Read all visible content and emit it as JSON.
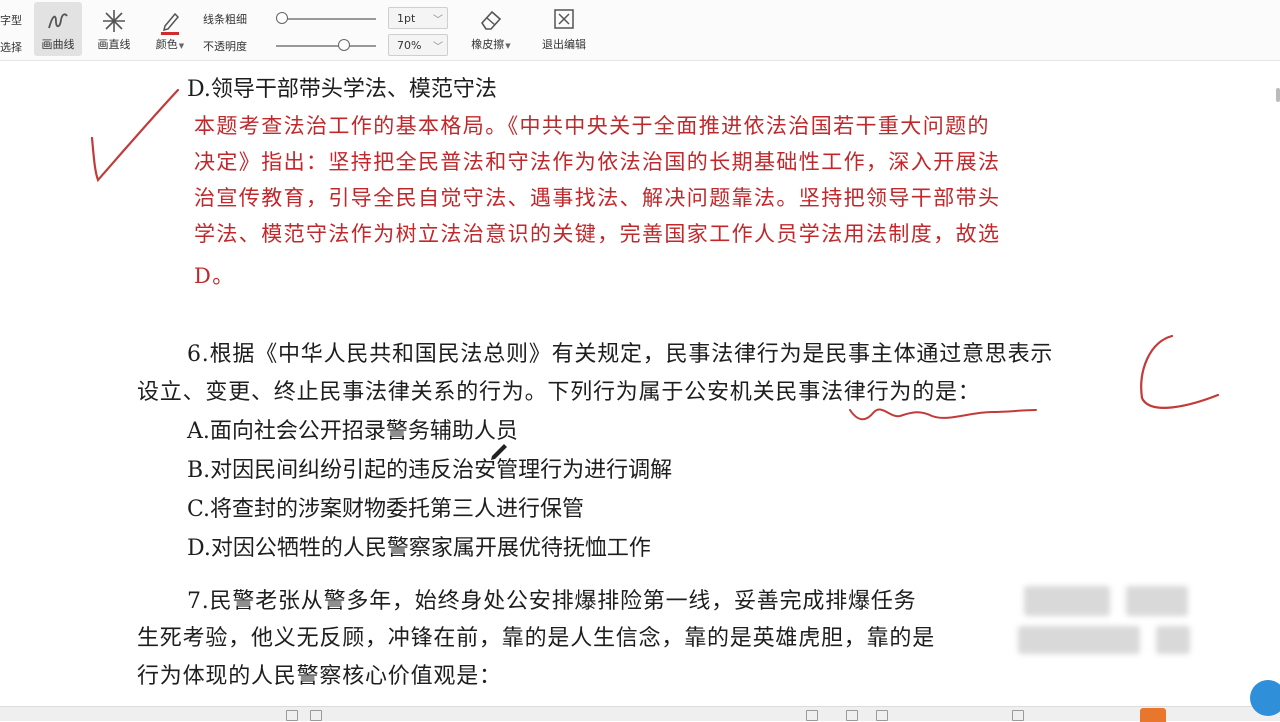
{
  "toolbar": {
    "cut_top": "字型",
    "cut_bottom": "选择",
    "curve_label": "画曲线",
    "straight_label": "画直线",
    "color_label": "颜色",
    "thickness_label": "线条粗细",
    "opacity_label": "不透明度",
    "thickness_value": "1pt",
    "opacity_value": "70%",
    "eraser_label": "橡皮擦",
    "exit_label": "退出编辑",
    "thickness_level": 0.0,
    "opacity_level": 0.7
  },
  "document": {
    "option_d": "D.领导干部带头学法、模范守法",
    "explanation": [
      "本题考查法治工作的基本格局。《中共中央关于全面推进依法治国若干重大问题的",
      "决定》指出：坚持把全民普法和守法作为依法治国的长期基础性工作，深入开展法",
      "治宣传教育，引导全民自觉守法、遇事找法、解决问题靠法。坚持把领导干部带头",
      "学法、模范守法作为树立法治意识的关键，完善国家工作人员学法用法制度，故选",
      "D。"
    ],
    "q6": {
      "line1": "6.根据《中华人民共和国民法总则》有关规定，民事法律行为是民事主体通过意思表示",
      "line2": "设立、变更、终止民事法律关系的行为。下列行为属于公安机关民事法律行为的是：",
      "options": [
        "A.面向社会公开招录警务辅助人员",
        "B.对因民间纠纷引起的违反治安管理行为进行调解",
        "C.将查封的涉案财物委托第三人进行保管",
        "D.对因公牺牲的人民警察家属开展优待抚恤工作"
      ]
    },
    "q7": {
      "line1": "7.民警老张从警多年，始终身处公安排爆排险第一线，妥善完成排爆任务",
      "line2": "生死考验，他义无反顾，冲锋在前，靠的是人生信念，靠的是英雄虎胆，靠的是",
      "line3": "行为体现的人民警察核心价值观是："
    }
  },
  "colors": {
    "annotation_red": "#c0282b",
    "ink_red": "#c23a3a",
    "toolbar_bg": "#fbfbfb"
  }
}
